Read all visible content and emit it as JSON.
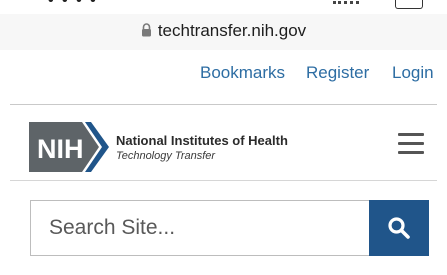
{
  "browser": {
    "url": "techtransfer.nih.gov"
  },
  "nav": {
    "bookmarks": "Bookmarks",
    "register": "Register",
    "login": "Login"
  },
  "header": {
    "logo_text": "NIH",
    "org_name": "National Institutes of Health",
    "org_subtitle": "Technology Transfer"
  },
  "search": {
    "placeholder": "Search Site..."
  },
  "icons": {
    "lock": "lock-icon",
    "menu": "hamburger-menu-icon",
    "search": "search-icon"
  },
  "colors": {
    "link": "#2d6da3",
    "search_button": "#20558a",
    "logo_gray": "#5e6468",
    "logo_blue": "#20558a"
  }
}
